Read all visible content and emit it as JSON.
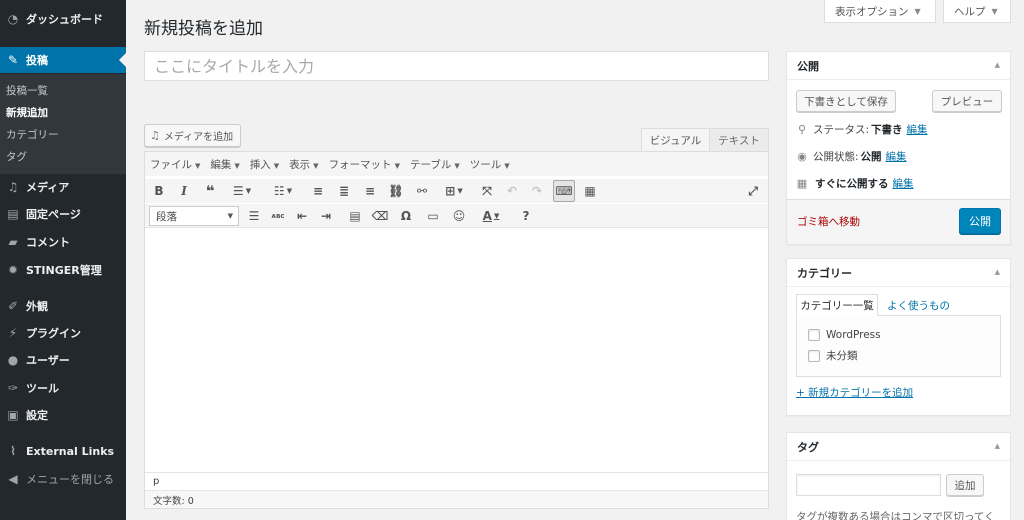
{
  "sidebar": {
    "items": [
      {
        "label": "ダッシュボード",
        "icon": "dashboard-icon"
      },
      {
        "label": "投稿",
        "icon": "pin-icon"
      },
      {
        "label": "メディア",
        "icon": "media-icon"
      },
      {
        "label": "固定ページ",
        "icon": "page-icon"
      },
      {
        "label": "コメント",
        "icon": "comment-icon"
      },
      {
        "label": "STINGER管理",
        "icon": "gear-icon"
      },
      {
        "label": "外観",
        "icon": "brush-icon"
      },
      {
        "label": "プラグイン",
        "icon": "plugin-icon"
      },
      {
        "label": "ユーザー",
        "icon": "user-icon"
      },
      {
        "label": "ツール",
        "icon": "wrench-icon"
      },
      {
        "label": "設定",
        "icon": "settings-icon"
      },
      {
        "label": "External Links",
        "icon": "link-icon"
      },
      {
        "label": "メニューを閉じる",
        "icon": "collapse-icon"
      }
    ],
    "submenu": [
      "投稿一覧",
      "新規追加",
      "カテゴリー",
      "タグ"
    ]
  },
  "screen_options": {
    "label": "表示オプション"
  },
  "help": {
    "label": "ヘルプ"
  },
  "page": {
    "title": "新規投稿を追加",
    "title_placeholder": "ここにタイトルを入力"
  },
  "editor": {
    "media_button": "メディアを追加",
    "tab_visual": "ビジュアル",
    "tab_text": "テキスト",
    "menubar": [
      "ファイル",
      "編集",
      "挿入",
      "表示",
      "フォーマット",
      "テーブル",
      "ツール"
    ],
    "format_select": "段落",
    "path": "p",
    "word_count": "文字数: 0"
  },
  "publish": {
    "title": "公開",
    "save_draft": "下書きとして保存",
    "preview": "プレビュー",
    "status_label": "ステータス:",
    "status_value": "下書き",
    "visibility_label": "公開状態:",
    "visibility_value": "公開",
    "schedule_label": "すぐに公開する",
    "edit": "編集",
    "trash": "ゴミ箱へ移動",
    "publish_button": "公開"
  },
  "category": {
    "title": "カテゴリー",
    "tab_all": "カテゴリー一覧",
    "tab_popular": "よく使うもの",
    "items": [
      "WordPress",
      "未分類"
    ],
    "add_link": "+ 新規カテゴリーを追加"
  },
  "tag": {
    "title": "タグ",
    "add_button": "追加",
    "help": "タグが複数ある場合はコンマで区切ってく"
  }
}
